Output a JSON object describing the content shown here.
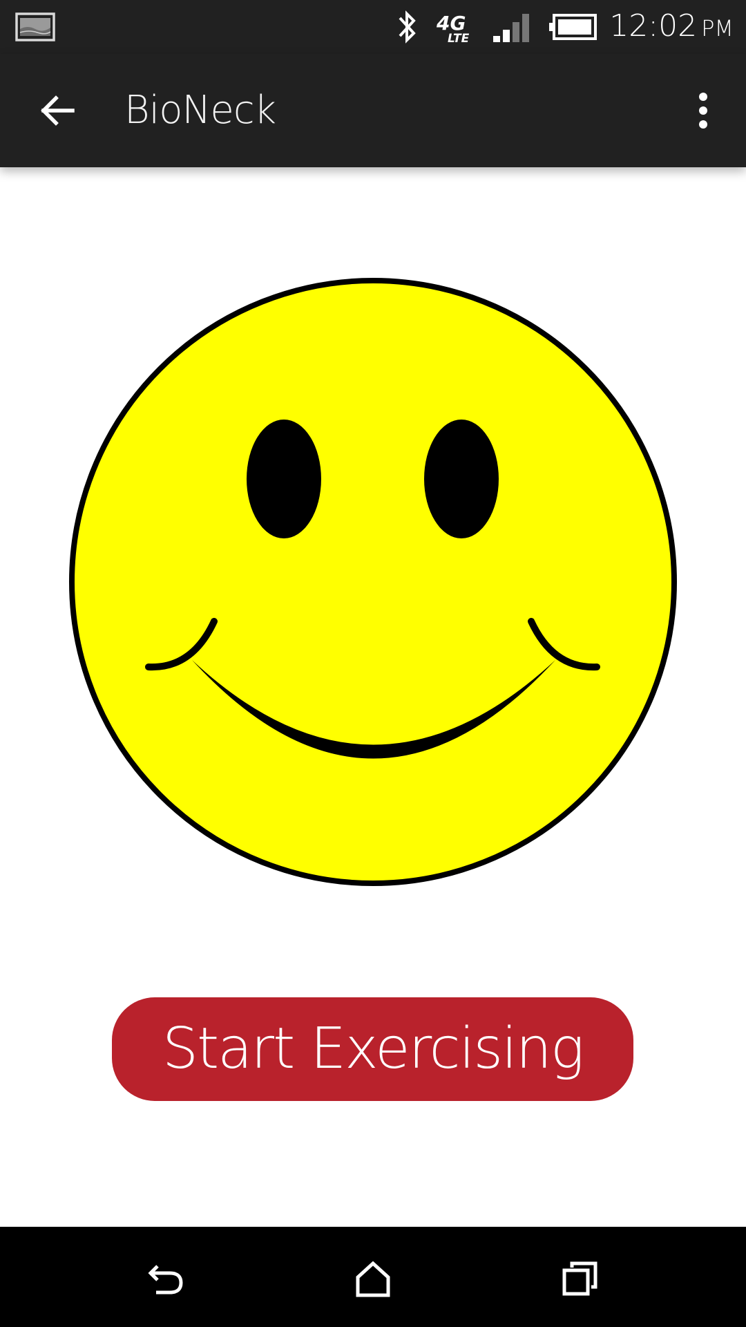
{
  "status_bar": {
    "time": "12:02",
    "ampm": "PM",
    "icons": [
      "gallery-icon",
      "bluetooth-icon",
      "4g-lte-icon",
      "signal-icon",
      "battery-icon"
    ],
    "network_label": "4G",
    "network_sub": "LTE"
  },
  "app_bar": {
    "title": "BioNeck",
    "back_icon": "arrow-left-icon",
    "menu_icon": "more-vert-icon"
  },
  "content": {
    "image": "smiley-face",
    "start_button_label": "Start Exercising"
  },
  "nav_bar": {
    "icons": [
      "back-icon",
      "home-icon",
      "recents-icon"
    ]
  },
  "colors": {
    "bar_bg": "#212121",
    "nav_bg": "#000000",
    "button_bg": "#b9222c",
    "smiley_fill": "#ffff00",
    "smiley_outline": "#000000"
  }
}
